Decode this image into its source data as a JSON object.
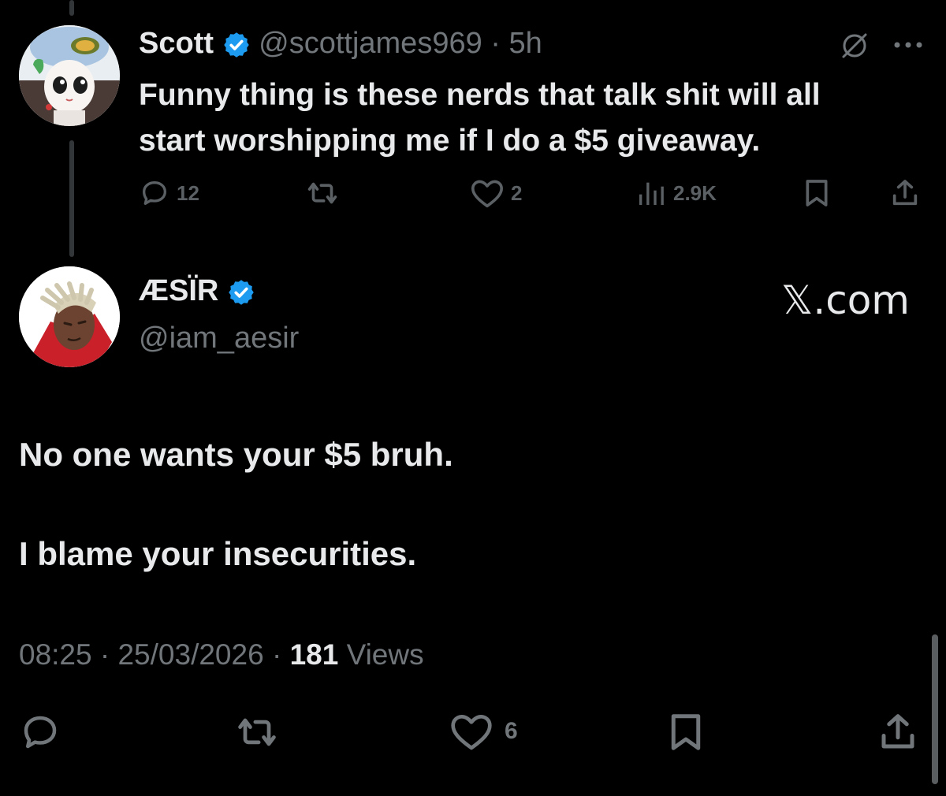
{
  "parent_tweet": {
    "display_name": "Scott",
    "handle": "@scottjames969",
    "separator": "·",
    "time": "5h",
    "text_line1": "Funny thing is these nerds that talk shit will all",
    "text_line2": "start worshipping me if I do a $5 giveaway.",
    "stats": {
      "replies": "12",
      "likes": "2",
      "views": "2.9K"
    }
  },
  "main_tweet": {
    "display_name": "ÆSÏR",
    "handle": "@iam_aesir",
    "brand": "𝕏.com",
    "text_line1": "No one wants your $5 bruh.",
    "text_line2": "I blame your insecurities.",
    "time": "08:25",
    "date": "25/03/2026",
    "separator": "·",
    "view_count": "181",
    "view_label": "Views",
    "stats": {
      "likes": "6"
    }
  },
  "colors": {
    "background": "#000000",
    "text": "#e7e9ea",
    "muted": "#71767b",
    "verified": "#1d9bf0"
  }
}
